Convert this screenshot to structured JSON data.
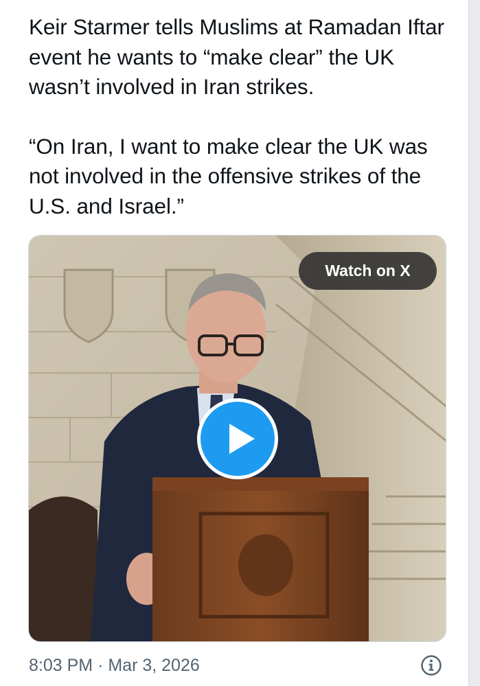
{
  "tweet": {
    "paragraph_1": "Keir Starmer tells Muslims at Ramadan Iftar event he wants to “make clear” the UK wasn’t involved in Iran strikes.",
    "paragraph_2": "“On Iran, I want to make clear the UK was not involved in the offensive strikes of the U.S. and Israel.”"
  },
  "media": {
    "watch_label": "Watch on X",
    "play_icon": "play-icon"
  },
  "footer": {
    "time": "8:03 PM",
    "separator": "·",
    "date": "Mar 3, 2026",
    "info_icon": "info-icon"
  },
  "colors": {
    "text": "#0f1419",
    "muted": "#536471",
    "accent": "#1d9bf0"
  }
}
